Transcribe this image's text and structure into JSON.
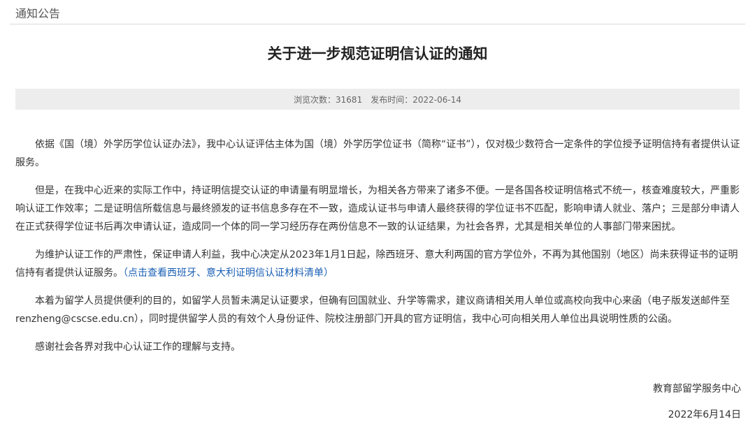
{
  "section": {
    "label": "通知公告"
  },
  "article": {
    "title": "关于进一步规范证明信认证的通知",
    "meta": {
      "views_label": "浏览次数：",
      "views": "31681",
      "date_label": "发布时间：",
      "date": "2022-06-14"
    },
    "paragraphs": {
      "p1": "依据《国（境）外学历学位认证办法》，我中心认证评估主体为国（境）外学历学位证书（简称“证书”），仅对极少数符合一定条件的学位授予证明信持有者提供认证服务。",
      "p2": "但是，在我中心近来的实际工作中，持证明信提交认证的申请量有明显增长，为相关各方带来了诸多不便。一是各国各校证明信格式不统一，核查难度较大，严重影响认证工作效率；二是证明信所载信息与最终颁发的证书信息多存在不一致，造成认证书与申请人最终获得的学位证书不匹配，影响申请人就业、落户；三是部分申请人在正式获得学位证书后再次申请认证，造成同一个体的同一学习经历存在两份信息不一致的认证结果，为社会各界，尤其是相关单位的人事部门带来困扰。",
      "p3_text": "为维护认证工作的严肃性，保证申请人利益，我中心决定从2023年1月1日起，除西班牙、意大利两国的官方学位外，不再为其他国别（地区）尚未获得证书的证明信持有者提供认证服务。",
      "p3_link": "（点击查看西班牙、意大利证明信认证材料清单）",
      "p4": "本着为留学人员提供便利的目的，如留学人员暂未满足认证要求，但确有回国就业、升学等需求，建议商请相关用人单位或高校向我中心来函（电子版发送邮件至renzheng@cscse.edu.cn），同时提供留学人员的有效个人身份证件、院校注册部门开具的官方证明信，我中心可向相关用人单位出具说明性质的公函。",
      "p5": "感谢社会各界对我中心认证工作的理解与支持。"
    },
    "signature": "教育部留学服务中心",
    "sign_date": "2022年6月14日"
  },
  "colors": {
    "link": "#1a5fb4",
    "meta_bg": "#ededed",
    "text": "#333333"
  }
}
